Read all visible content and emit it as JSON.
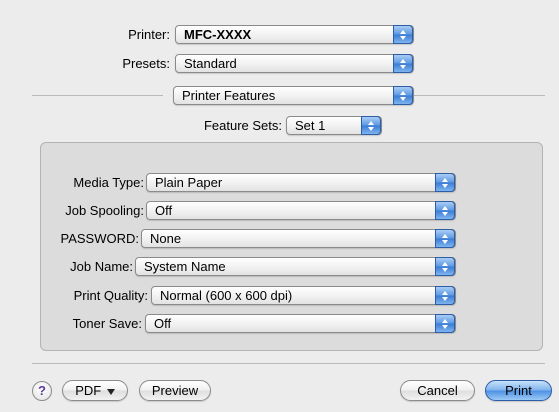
{
  "printer": {
    "label": "Printer:",
    "value": "MFC-XXXX"
  },
  "presets": {
    "label": "Presets:",
    "value": "Standard"
  },
  "panel": {
    "value": "Printer Features"
  },
  "feature_sets": {
    "label": "Feature Sets:",
    "value": "Set 1"
  },
  "options": [
    {
      "label": "Media Type:",
      "value": "Plain Paper"
    },
    {
      "label": "Job Spooling:",
      "value": "Off"
    },
    {
      "label": "PASSWORD:",
      "value": "None"
    },
    {
      "label": "Job Name:",
      "value": "System Name"
    },
    {
      "label": "Print Quality:",
      "value": "Normal (600 x 600 dpi)"
    },
    {
      "label": "Toner Save:",
      "value": "Off"
    }
  ],
  "footer": {
    "help": "?",
    "pdf": "PDF",
    "preview": "Preview",
    "cancel": "Cancel",
    "print": "Print"
  }
}
